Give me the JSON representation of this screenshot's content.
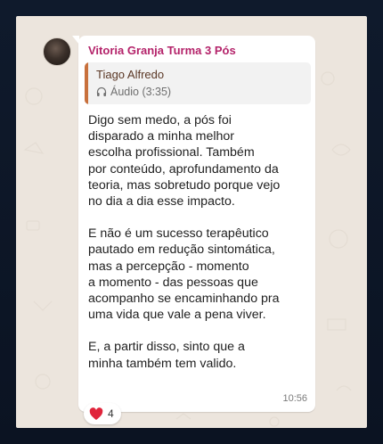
{
  "message": {
    "sender": "Vitoria Granja Turma 3 Pós",
    "quote": {
      "name": "Tiago Alfredo",
      "media_label": "Áudio (3:35)",
      "icon": "headphones-icon"
    },
    "paragraphs": [
      "Digo sem medo, a pós foi\ndisparado a minha melhor\nescolha profissional. Também\npor conteúdo, aprofundamento da\nteoria, mas sobretudo porque vejo\nno dia a dia esse impacto.",
      "E não é um sucesso terapêutico\npautado em redução sintomática,\nmas a percepção - momento\na momento - das pessoas que\nacompanho se encaminhando pra\numa vida que vale a pena viver.",
      " E, a partir disso, sinto que a\nminha também tem valido."
    ],
    "time": "10:56",
    "reaction": {
      "icon": "heart-icon",
      "count": "4"
    }
  },
  "colors": {
    "sender": "#b4236a",
    "quote_bar": "#c8703c",
    "chat_bg": "#ece5dd",
    "heart": "#e0243b"
  }
}
